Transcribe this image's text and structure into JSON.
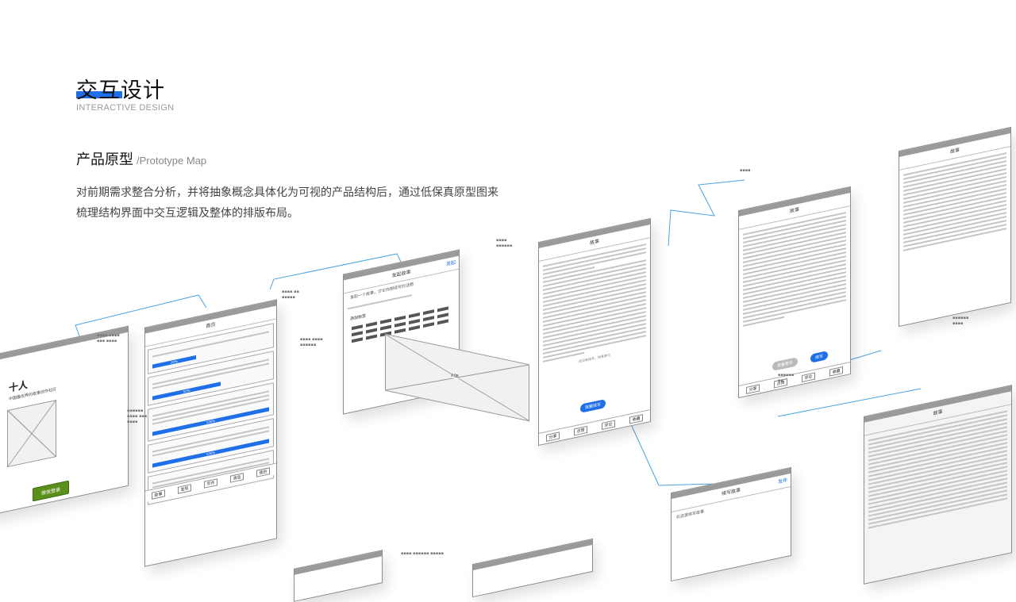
{
  "header": {
    "title": "交互设计",
    "subtitle_en": "INTERACTIVE DESIGN",
    "accent": "#1e6fe8"
  },
  "section": {
    "title": "产品原型",
    "title_en": "/Prototype Map",
    "description": "对前期需求整合分析，并将抽象概念具体化为可视的产品结构后，通过低保真原型图来梳理结构界面中交互逻辑及整体的排版布局。"
  },
  "wireframes": {
    "welcome": {
      "app_name": "十人",
      "slogan": "中国最优秀的故事创作社区",
      "login_button": "微信登录"
    },
    "home": {
      "nav_title": "首页",
      "progress": [
        "20%",
        "50%",
        "100%",
        "100%",
        "100%"
      ],
      "tabs": [
        "故事",
        "发现",
        "写作",
        "消息",
        "我的"
      ]
    },
    "publish": {
      "nav_title": "发起故事",
      "nav_action": "发起",
      "placeholder": "发起一个故事，讨论你想续写的话题",
      "tags_title": "添加标签",
      "image_label": "封面"
    },
    "story": {
      "nav_title": "故事",
      "tabs": [
        "分享",
        "点赞",
        "评论",
        "收藏"
      ],
      "cta": "我要续写",
      "note": "还没有续写，快来参与"
    },
    "story2": {
      "nav_title": "故事",
      "tabs": [
        "分享",
        "点赞",
        "评论",
        "收藏"
      ],
      "cta": "续写",
      "secondary": "查看更多"
    },
    "write": {
      "nav_title": "续写故事",
      "nav_action": "发布",
      "placeholder": "在这里续写故事"
    },
    "story3": {
      "nav_title": "故事"
    },
    "story4": {
      "nav_title": "故事"
    }
  }
}
